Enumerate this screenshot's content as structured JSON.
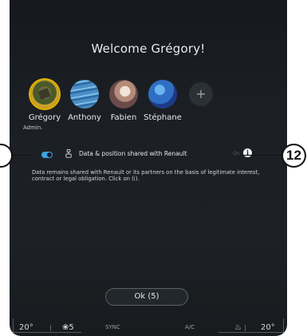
{
  "screen": {
    "title": "Welcome Grégory!"
  },
  "profiles": [
    {
      "name": "Grégory",
      "role": "Admin.",
      "selected": true,
      "icon": "avatar-gregory"
    },
    {
      "name": "Anthony",
      "role": "",
      "selected": false,
      "icon": "avatar-anthony"
    },
    {
      "name": "Fabien",
      "role": "",
      "selected": false,
      "icon": "avatar-fabien"
    },
    {
      "name": "Stéphane",
      "role": "",
      "selected": false,
      "icon": "avatar-stephane"
    }
  ],
  "add_profile": {
    "icon": "plus-icon",
    "symbol": "+"
  },
  "data_sharing": {
    "label": "Data & position shared with Renault",
    "state_text": "On",
    "info_symbol": "i",
    "description": "Data remains shared with Renault or its partners on the basis of legitimate interest, contract or legal obligation. Click on (i)."
  },
  "ok_button": {
    "label": "Ok (5)"
  },
  "climate_bar": {
    "temp_left": "20",
    "fan_level": "5",
    "sync_label": "SYNC",
    "ac_label": "A/C",
    "temp_right": "20"
  },
  "callouts": {
    "right_number": "12"
  },
  "colors": {
    "accent_selected": "#e6b400",
    "toggle_on": "#3fa0e0",
    "screen_bg": "#1b1f23"
  }
}
